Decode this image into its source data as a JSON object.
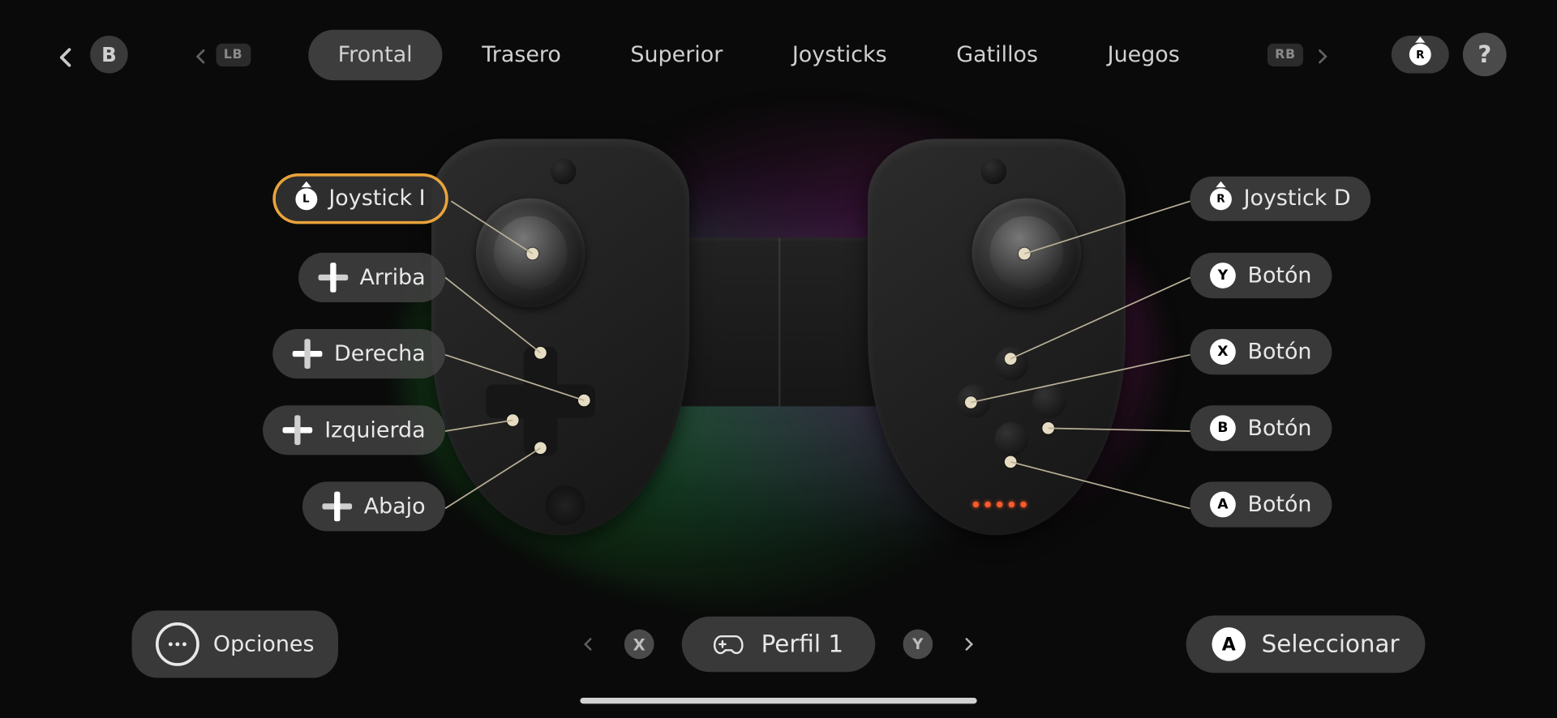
{
  "header": {
    "back_letter": "B",
    "lb": "LB",
    "rb": "RB",
    "tabs": [
      "Frontal",
      "Trasero",
      "Superior",
      "Joysticks",
      "Gatillos",
      "Juegos"
    ],
    "active_tab": 0,
    "right_stick_letter": "R",
    "help": "?"
  },
  "labels_left": [
    {
      "icon": "joy",
      "letter": "L",
      "text": "Joystick I",
      "selected": true
    },
    {
      "icon": "dpad",
      "dir": "up",
      "text": "Arriba"
    },
    {
      "icon": "dpad",
      "dir": "right",
      "text": "Derecha"
    },
    {
      "icon": "dpad",
      "dir": "left",
      "text": "Izquierda"
    },
    {
      "icon": "dpad",
      "dir": "down",
      "text": "Abajo"
    }
  ],
  "labels_right": [
    {
      "icon": "joy",
      "letter": "R",
      "text": "Joystick D"
    },
    {
      "icon": "letter",
      "letter": "Y",
      "text": "Botón"
    },
    {
      "icon": "letter",
      "letter": "X",
      "text": "Botón"
    },
    {
      "icon": "letter",
      "letter": "B",
      "text": "Botón"
    },
    {
      "icon": "letter",
      "letter": "A",
      "text": "Botón"
    }
  ],
  "footer": {
    "options": "Opciones",
    "profile": "Perfil 1",
    "prev_hint": "X",
    "next_hint": "Y",
    "select_letter": "A",
    "select_label": "Seleccionar"
  }
}
